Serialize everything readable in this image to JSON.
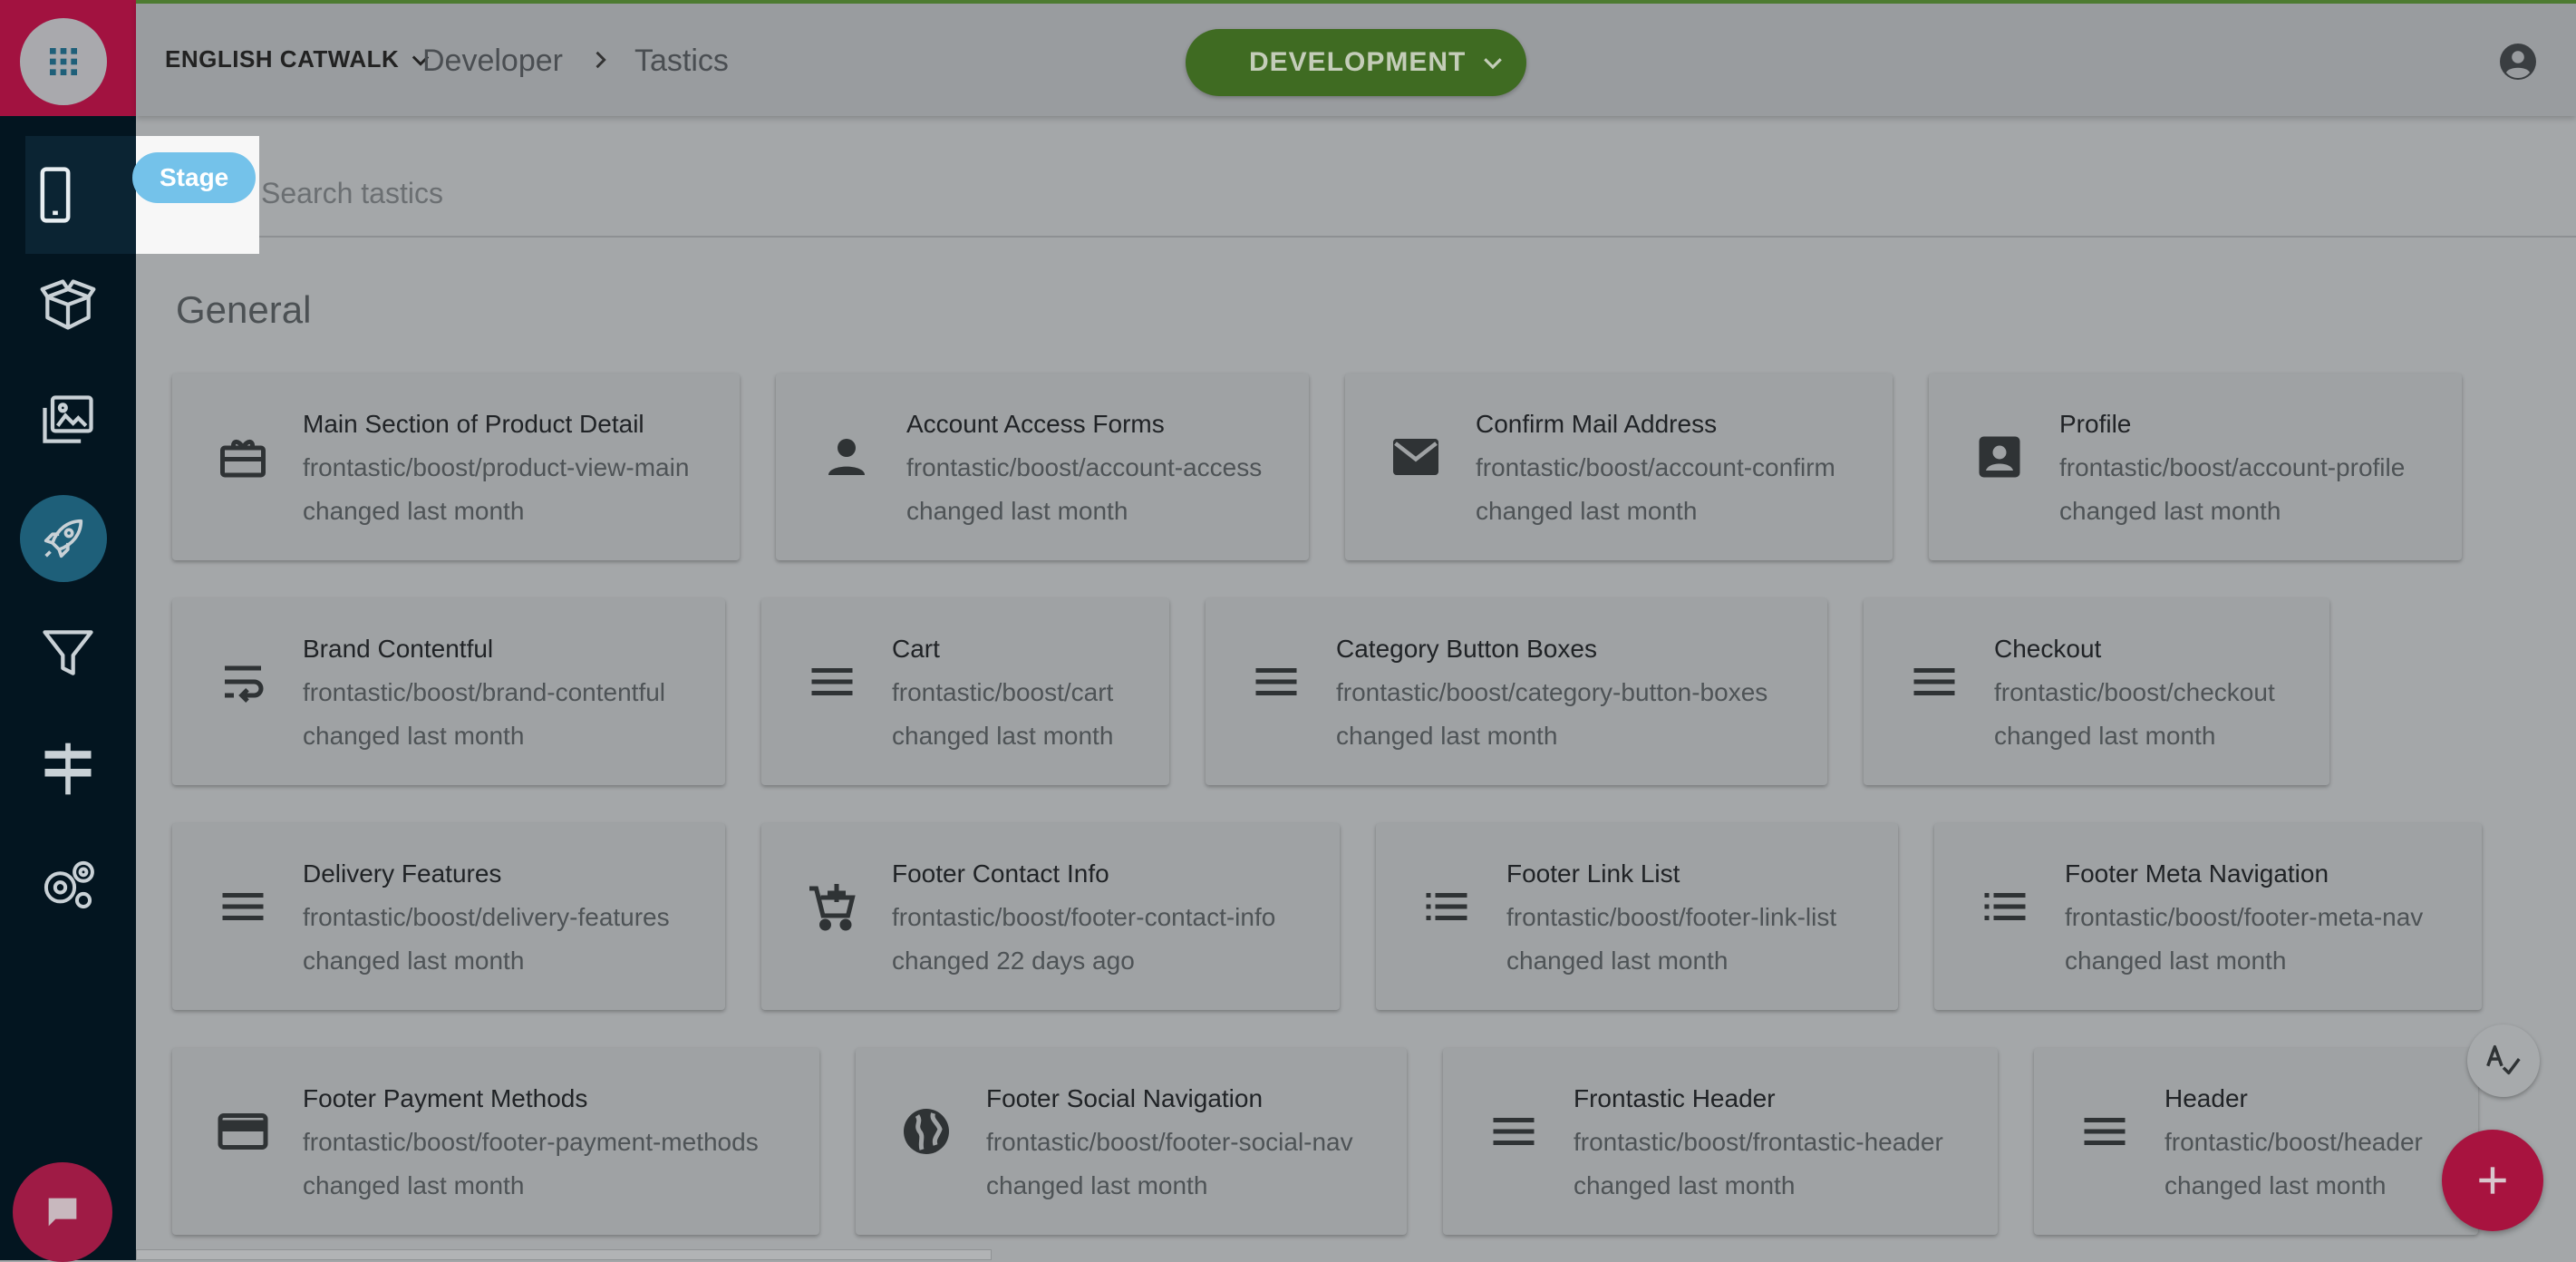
{
  "topbar": {
    "project": "ENGLISH CATWALK",
    "breadcrumb": [
      "Developer",
      "Tastics"
    ],
    "environment": "DEVELOPMENT"
  },
  "tooltip": {
    "label": "Stage"
  },
  "search": {
    "placeholder": "Search tastics"
  },
  "section": {
    "title": "General"
  },
  "tiles": [
    {
      "name": "Main Section of Product Detail",
      "path": "frontastic/boost/product-view-main",
      "changed": "changed last month",
      "icon": "gift-card-icon"
    },
    {
      "name": "Account Access Forms",
      "path": "frontastic/boost/account-access",
      "changed": "changed last month",
      "icon": "person-icon"
    },
    {
      "name": "Confirm Mail Address",
      "path": "frontastic/boost/account-confirm",
      "changed": "changed last month",
      "icon": "mail-icon"
    },
    {
      "name": "Profile",
      "path": "frontastic/boost/account-profile",
      "changed": "changed last month",
      "icon": "account-box-icon"
    },
    {
      "name": "Brand Contentful",
      "path": "frontastic/boost/brand-contentful",
      "changed": "changed last month",
      "icon": "wrap-text-icon"
    },
    {
      "name": "Cart",
      "path": "frontastic/boost/cart",
      "changed": "changed last month",
      "icon": "menu-lines-icon"
    },
    {
      "name": "Category Button Boxes",
      "path": "frontastic/boost/category-button-boxes",
      "changed": "changed last month",
      "icon": "menu-lines-icon"
    },
    {
      "name": "Checkout",
      "path": "frontastic/boost/checkout",
      "changed": "changed last month",
      "icon": "menu-lines-icon"
    },
    {
      "name": "Delivery Features",
      "path": "frontastic/boost/delivery-features",
      "changed": "changed last month",
      "icon": "menu-lines-icon"
    },
    {
      "name": "Footer Contact Info",
      "path": "frontastic/boost/footer-contact-info",
      "changed": "changed 22 days ago",
      "icon": "add-cart-icon"
    },
    {
      "name": "Footer Link List",
      "path": "frontastic/boost/footer-link-list",
      "changed": "changed last month",
      "icon": "list-icon"
    },
    {
      "name": "Footer Meta Navigation",
      "path": "frontastic/boost/footer-meta-nav",
      "changed": "changed last month",
      "icon": "list-icon"
    },
    {
      "name": "Footer Payment Methods",
      "path": "frontastic/boost/footer-payment-methods",
      "changed": "changed last month",
      "icon": "credit-card-icon"
    },
    {
      "name": "Footer Social Navigation",
      "path": "frontastic/boost/footer-social-nav",
      "changed": "changed last month",
      "icon": "globe-icon"
    },
    {
      "name": "Frontastic Header",
      "path": "frontastic/boost/frontastic-header",
      "changed": "changed last month",
      "icon": "menu-lines-icon"
    },
    {
      "name": "Header",
      "path": "frontastic/boost/header",
      "changed": "changed last month",
      "icon": "menu-lines-icon"
    }
  ],
  "colors": {
    "sidebar": "#031520",
    "apps_area": "#a21240",
    "environment_button": "#3f6b22",
    "fab_add": "#a8133f",
    "tooltip": "#74c2ea"
  }
}
